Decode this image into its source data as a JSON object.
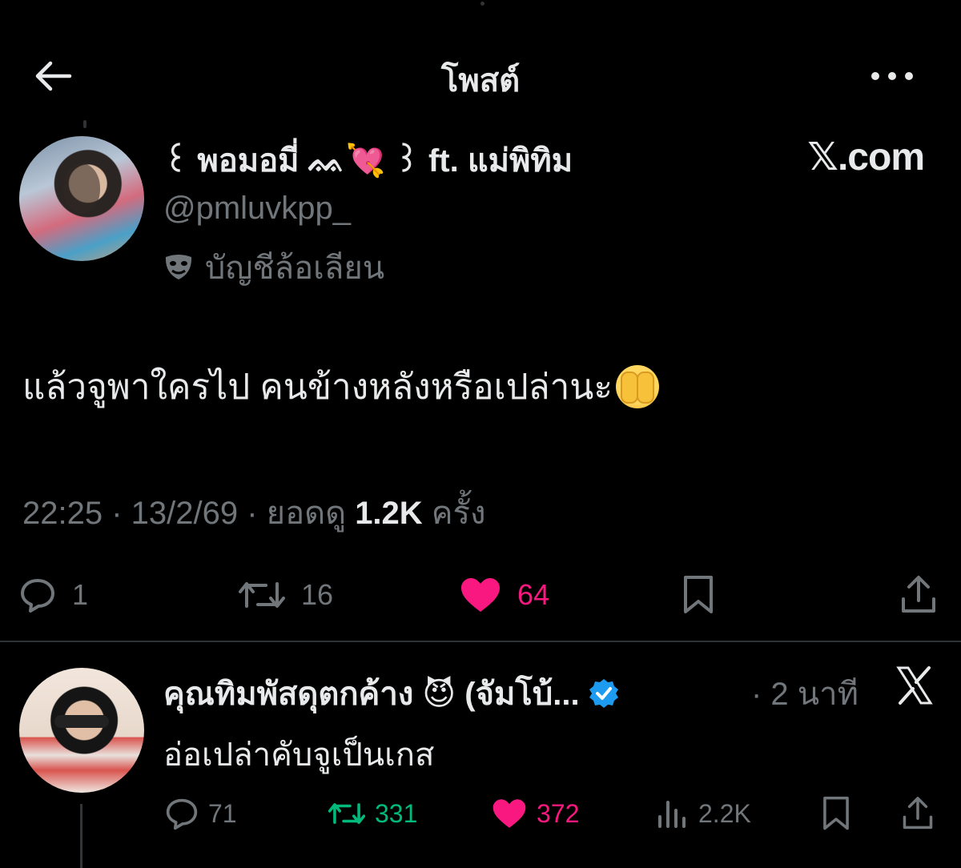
{
  "topbar": {
    "title": "โพสต์"
  },
  "post": {
    "display_name": "꒰ พอมอมี่ ᨐ💘 ꒱ ft. แม่พิทิม",
    "handle": "@pmluvkpp_",
    "parody_label": "บัญชีล้อเลียน",
    "source_badge": "𝕏.com",
    "text": "แล้วจูพาใครไป คนข้างหลังหรือเปล่านะ",
    "time": "22:25 · 13/2/69 · ยอดดู ",
    "views": "1.2K",
    "views_suffix": " ครั้ง",
    "replies": "1",
    "reposts": "16",
    "likes": "64"
  },
  "reply": {
    "display_name": "คุณทิมพัสดุตกค้าง 😈 (จัมโบ้...",
    "time": "· 2 นาที",
    "text": "อ่อเปล่าคับจูเป็นเกส",
    "replies": "71",
    "reposts": "331",
    "likes": "372",
    "views": "2.2K"
  },
  "colors": {
    "like": "#f91880",
    "repost": "#00ba7c",
    "muted": "#71767b",
    "verified": "#1d9bf0"
  }
}
